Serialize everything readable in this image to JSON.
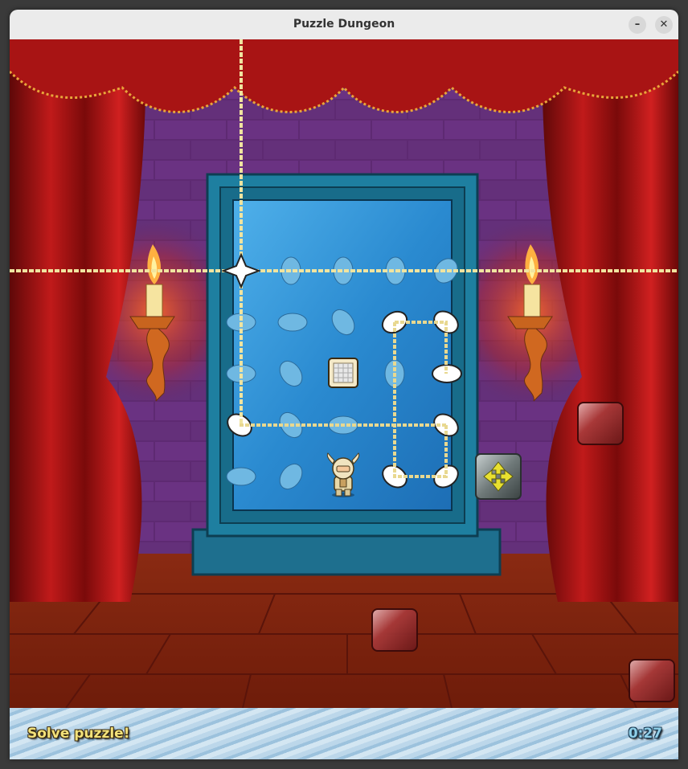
{
  "window": {
    "title": "Puzzle Dungeon",
    "minimize_label": "–",
    "close_label": "✕"
  },
  "status": {
    "message": "Solve puzzle!",
    "timer": "0:27"
  },
  "scene": {
    "icons": {
      "player": "knight-character-icon",
      "move": "move-arrows-icon",
      "target": "grate-tile-icon",
      "star": "star-icon"
    },
    "colors": {
      "wall": "#5a2a6a",
      "curtain": "#b81818",
      "mirror_frame": "#1e7fa0",
      "mirror_glass": "#2a8fd0",
      "floor": "#8a2a10",
      "rope": "#e8d890"
    }
  }
}
